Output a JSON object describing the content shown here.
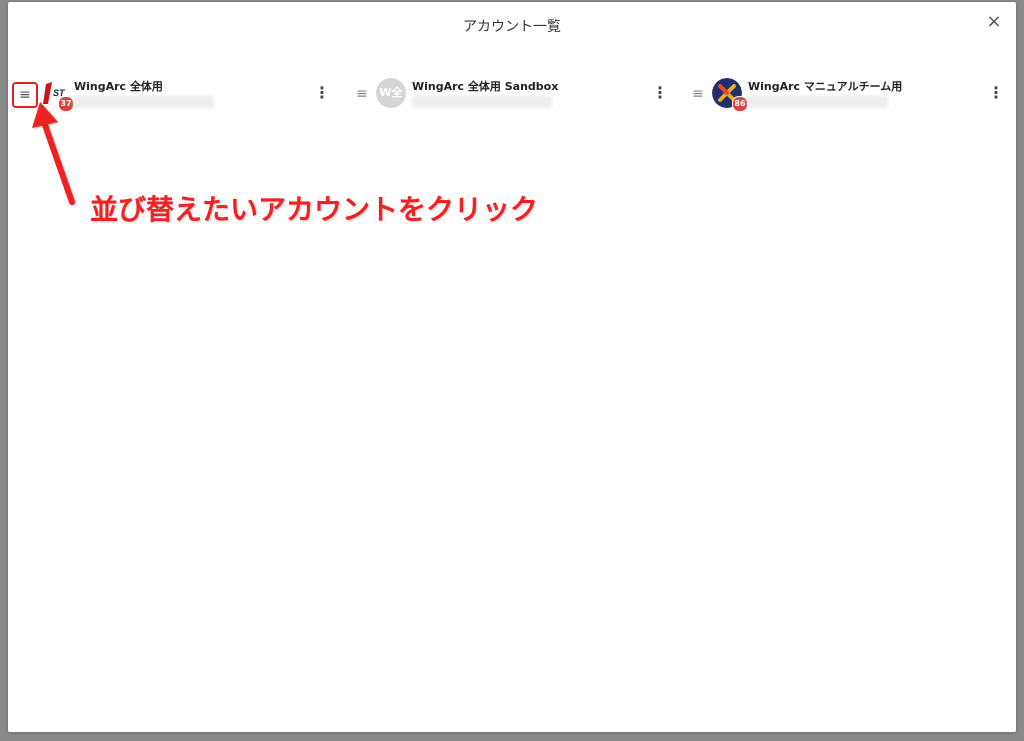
{
  "dialog": {
    "title": "アカウント一覧",
    "close_label": "×"
  },
  "accounts": [
    {
      "name": "WingArc 全体用",
      "badge": "37",
      "avatar_icon": "1st-logo-icon",
      "handle_icon": "≡",
      "menu_icon": "⋮"
    },
    {
      "name": "WingArc 全体用 Sandbox",
      "badge": "",
      "avatar_text": "W全",
      "avatar_icon": "w-initial-icon",
      "handle_icon": "≡",
      "menu_icon": "⋮"
    },
    {
      "name": "WingArc マニュアルチーム用",
      "badge": "86",
      "avatar_icon": "x-logo-icon",
      "handle_icon": "≡",
      "menu_icon": "⋮"
    }
  ],
  "annotation": {
    "text": "並び替えたいアカウントをクリック",
    "color": "#ee2222"
  }
}
